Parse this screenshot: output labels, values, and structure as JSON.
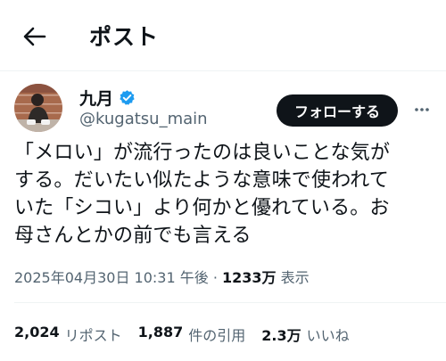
{
  "header": {
    "title": "ポスト"
  },
  "author": {
    "name": "九月",
    "handle": "@kugatsu_main",
    "follow_label": "フォローする"
  },
  "post": {
    "lines": [
      "「メロい」が流行ったのは良いことな気が",
      "する。だいたい似たような意味で使われて",
      "いた「シコい」より何かと優れている。お",
      "母さんとかの前でも言える"
    ],
    "timestamp": "2025年04月30日 10:31 午後",
    "separator": " · ",
    "views": "1233万",
    "views_label": " 表示"
  },
  "stats": {
    "reposts": {
      "count": "2,024",
      "label": "リポスト"
    },
    "quotes": {
      "count": "1,887",
      "label": "件の引用"
    },
    "likes": {
      "count": "2.3万",
      "label": "いいね"
    }
  },
  "colors": {
    "text": "#0f1419",
    "secondary": "#536471",
    "verified": "#1d9bf0",
    "border": "#eff3f4"
  },
  "icons": [
    "back-arrow-icon",
    "verified-badge-icon",
    "more-icon"
  ]
}
